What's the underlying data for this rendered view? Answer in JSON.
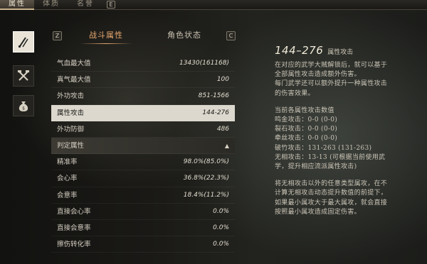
{
  "top_tabs": [
    {
      "label": "属性",
      "active": true
    },
    {
      "label": "体质",
      "active": false
    },
    {
      "label": "名誉",
      "active": false
    }
  ],
  "top_key": "E",
  "sidebar_icons": [
    "brush-pen-icon",
    "crossed-weapons-icon",
    "money-bag-icon"
  ],
  "sub_key_left": "Z",
  "sub_key_right": "C",
  "sub_tabs": [
    {
      "label": "战斗属性",
      "active": true
    },
    {
      "label": "角色状态",
      "active": false
    }
  ],
  "stats": [
    {
      "label": "气血最大值",
      "value": "13430(161168)"
    },
    {
      "label": "真气最大值",
      "value": "100"
    },
    {
      "label": "外功攻击",
      "value": "851-1566"
    },
    {
      "label": "属性攻击",
      "value": "144-276",
      "selected": true
    },
    {
      "label": "外功防御",
      "value": "486"
    }
  ],
  "section_label": "判定属性",
  "judgement_stats": [
    {
      "label": "精准率",
      "value": "98.0%(85.0%)"
    },
    {
      "label": "会心率",
      "value": "36.8%(22.3%)"
    },
    {
      "label": "会意率",
      "value": "18.4%(11.2%)"
    },
    {
      "label": "直接会心率",
      "value": "0.0%"
    },
    {
      "label": "直接会意率",
      "value": "0.0%"
    },
    {
      "label": "擦伤转化率",
      "value": "0.0%"
    }
  ],
  "detail": {
    "range": "144–276",
    "name": "属性攻击",
    "para1": [
      "在对应的武学大贼解锁后，就可以基于",
      "全部属性攻击造成额外伤害。",
      "每门武学还可以额外提升一种属性攻击",
      "的伤害效果。"
    ],
    "para2": [
      "当前各属性攻击数值",
      "鸣金攻击：0-0 (0-0)",
      "裂石攻击：0-0 (0-0)",
      "牵丝攻击：0-0 (0-0)",
      "破竹攻击：131-263 (131-263)",
      "无相攻击：13-13 (可根据当前使用武",
      "学，提升相应流派属性攻击)"
    ],
    "para3": [
      "将无相攻击以外的任意类型属攻，在不",
      "计算无相攻击动态提升数值的前提下，",
      "如果最小属攻大于最大属攻，就会直接",
      "按照最小属攻造成固定伤害。"
    ]
  }
}
